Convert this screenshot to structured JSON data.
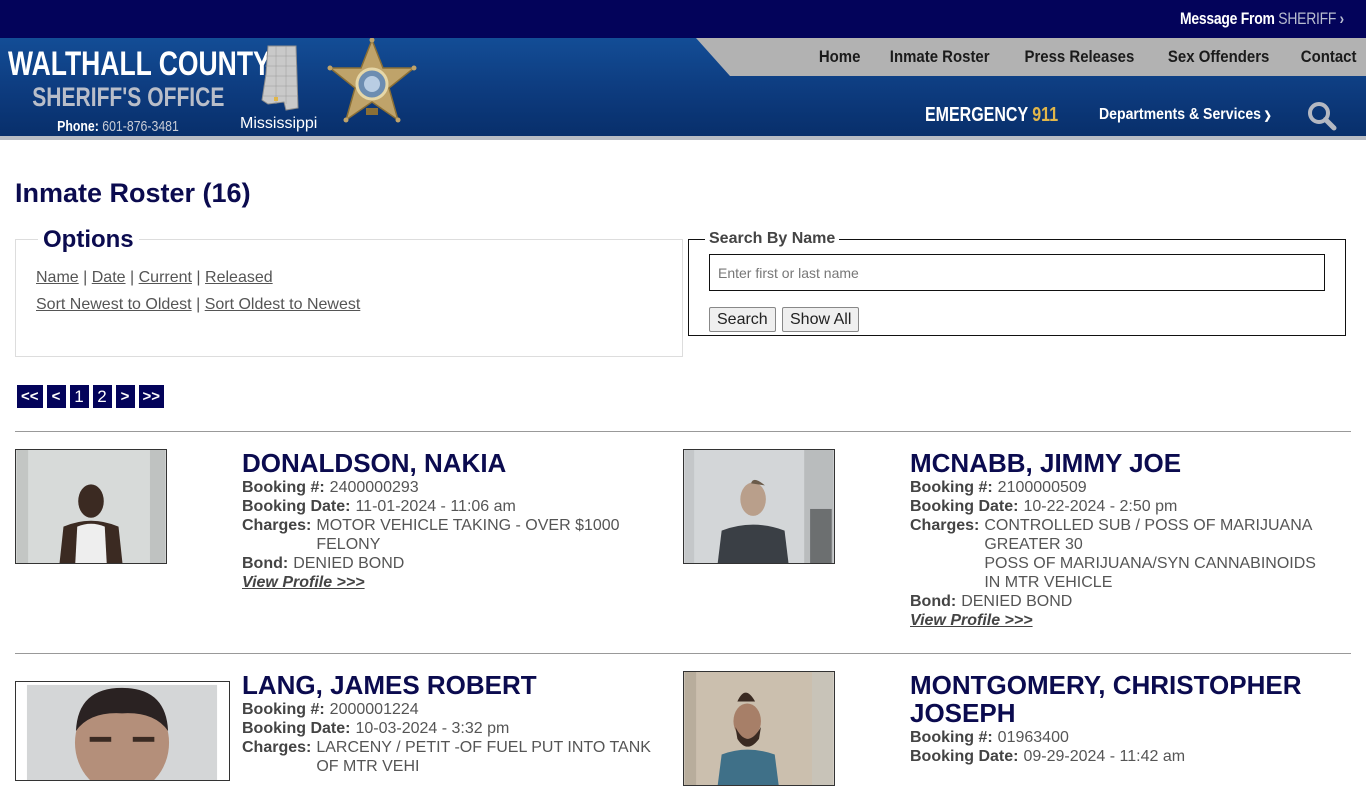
{
  "topbar": {
    "message_prefix": "Message From",
    "message_highlight": "SHERIFF",
    "message_chevron": "›"
  },
  "header": {
    "county": "WALTHALL COUNTY",
    "office": "SHERIFF'S OFFICE",
    "phone_label": "Phone:",
    "phone_number": "601-876-3481",
    "state_label": "Mississippi",
    "nav": [
      "Home",
      "Inmate Roster",
      "Press Releases",
      "Sex Offenders",
      "Contact"
    ],
    "emergency_label": "EMERGENCY",
    "emergency_number": "911",
    "departments_label": "Departments & Services",
    "icons": {
      "search": "search-icon",
      "map": "mississippi-map-icon",
      "badge": "sheriff-badge-icon"
    },
    "colors": {
      "topbar": "#03035a",
      "header": "#0d3b7e",
      "accent": "#e1b64a",
      "title": "#0b0b4f"
    }
  },
  "page": {
    "title": "Inmate Roster (16)"
  },
  "options": {
    "legend": "Options",
    "filters": [
      "Name",
      "Date",
      "Current",
      "Released"
    ],
    "sorts": [
      "Sort Newest to Oldest",
      "Sort Oldest to Newest"
    ],
    "separator": "|"
  },
  "search": {
    "legend": "Search By Name",
    "placeholder": "Enter first or last name",
    "value": "",
    "search_button": "Search",
    "show_all_button": "Show All"
  },
  "pagination": {
    "first": "<<",
    "prev": "<",
    "pages": [
      "1",
      "2"
    ],
    "current_page": "1",
    "next": ">",
    "last": ">>"
  },
  "labels": {
    "booking_number": "Booking #:",
    "booking_date": "Booking Date:",
    "charges": "Charges:",
    "bond": "Bond:",
    "view_profile": "View Profile >>>"
  },
  "inmates": [
    {
      "name": "DONALDSON, NAKIA",
      "booking_number": "2400000293",
      "booking_date": "11-01-2024 - 11:06 am",
      "charges": [
        "MOTOR VEHICLE TAKING - OVER $1000 FELONY"
      ],
      "bond": "DENIED BOND"
    },
    {
      "name": "MCNABB, JIMMY JOE",
      "booking_number": "2100000509",
      "booking_date": "10-22-2024 - 2:50 pm",
      "charges": [
        "CONTROLLED SUB / POSS OF MARIJUANA GREATER 30",
        "POSS OF MARIJUANA/SYN CANNABINOIDS IN MTR VEHICLE"
      ],
      "bond": "DENIED BOND"
    },
    {
      "name": "LANG, JAMES ROBERT",
      "booking_number": "2000001224",
      "booking_date": "10-03-2024 - 3:32 pm",
      "charges": [
        "LARCENY / PETIT -OF FUEL PUT INTO TANK OF MTR VEHI"
      ]
    },
    {
      "name": "MONTGOMERY, CHRISTOPHER JOSEPH",
      "booking_number": "01963400",
      "booking_date": "09-29-2024 - 11:42 am"
    }
  ]
}
